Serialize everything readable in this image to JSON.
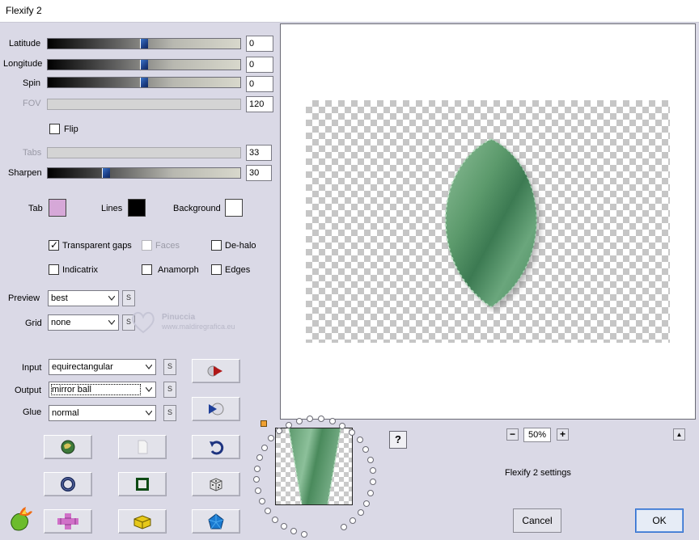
{
  "window": {
    "title": "Flexify 2"
  },
  "sliders": [
    {
      "id": "latitude",
      "label": "Latitude",
      "value": "0",
      "position": 0.5,
      "enabled": true
    },
    {
      "id": "longitude",
      "label": "Longitude",
      "value": "0",
      "position": 0.5,
      "enabled": true
    },
    {
      "id": "spin",
      "label": "Spin",
      "value": "0",
      "position": 0.5,
      "enabled": true
    },
    {
      "id": "fov",
      "label": "FOV",
      "value": "120",
      "enabled": false
    },
    {
      "id": "tabs",
      "label": "Tabs",
      "value": "33",
      "enabled": false
    },
    {
      "id": "sharpen",
      "label": "Sharpen",
      "value": "30",
      "position": 0.3,
      "enabled": true
    }
  ],
  "flip": {
    "label": "Flip",
    "checked": false
  },
  "colors": {
    "tab": {
      "label": "Tab",
      "color": "#d6a8d8"
    },
    "lines": {
      "label": "Lines",
      "color": "#000000"
    },
    "background": {
      "label": "Background",
      "color": "#ffffff"
    }
  },
  "options": {
    "transparent_gaps": {
      "label": "Transparent gaps",
      "checked": true
    },
    "faces": {
      "label": "Faces",
      "checked": false,
      "enabled": false
    },
    "dehalo": {
      "label": "De-halo",
      "checked": false
    },
    "indicatrix": {
      "label": "Indicatrix",
      "checked": false
    },
    "anamorph": {
      "label": "Anamorph",
      "checked": false
    },
    "edges": {
      "label": "Edges",
      "checked": false
    }
  },
  "preview_select": {
    "label": "Preview",
    "value": "best"
  },
  "grid_select": {
    "label": "Grid",
    "value": "none"
  },
  "input_select": {
    "label": "Input",
    "value": "equirectangular"
  },
  "output_select": {
    "label": "Output",
    "value": "mirror ball"
  },
  "glue_select": {
    "label": "Glue",
    "value": "normal"
  },
  "s_button_label": "S",
  "watermark": {
    "name": "Pinuccia",
    "url": "www.maldiregrafica.eu"
  },
  "zoom": {
    "value": "50%",
    "minus": "−",
    "plus": "+"
  },
  "settings_label": "Flexify 2 settings",
  "help_label": "?",
  "collapse_label": "▲",
  "buttons": {
    "cancel": "Cancel",
    "ok": "OK"
  },
  "accent": {
    "leaf_green": "#5e9a6e",
    "slider_thumb": "#2a5aa8"
  }
}
